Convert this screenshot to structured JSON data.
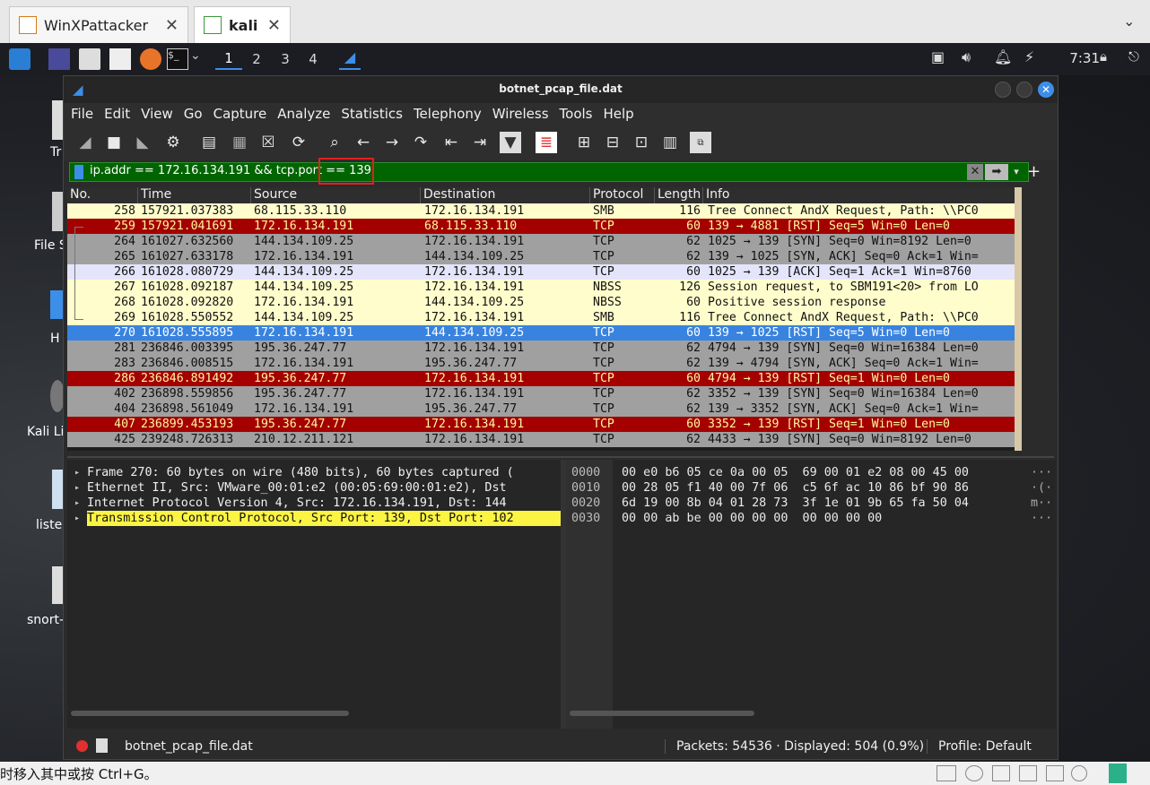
{
  "host": {
    "tabs": [
      {
        "label": "WinXPattacker"
      },
      {
        "label": "kali"
      }
    ],
    "status_hint": "时移入其中或按 Ctrl+G。"
  },
  "kali_panel": {
    "workspaces": [
      "1",
      "2",
      "3",
      "4"
    ],
    "clock": "7:31"
  },
  "desktop": {
    "icons": [
      {
        "label": "Tr"
      },
      {
        "label": "File S"
      },
      {
        "label": "H"
      },
      {
        "label": "Kali Li"
      },
      {
        "label": "liste"
      },
      {
        "label": "snort-"
      }
    ]
  },
  "window": {
    "title": "botnet_pcap_file.dat",
    "menus": [
      "File",
      "Edit",
      "View",
      "Go",
      "Capture",
      "Analyze",
      "Statistics",
      "Telephony",
      "Wireless",
      "Tools",
      "Help"
    ],
    "filter": "ip.addr == 172.16.134.191 && tcp.port == 139",
    "columns": [
      "No.",
      "Time",
      "Source",
      "Destination",
      "Protocol",
      "Length",
      "Info"
    ],
    "packets": [
      {
        "no": "258",
        "time": "157921.037383",
        "src": "68.115.33.110",
        "dst": "172.16.134.191",
        "proto": "SMB",
        "len": "116",
        "info": "Tree Connect AndX Request, Path: \\\\PC0",
        "style": "yellow"
      },
      {
        "no": "259",
        "time": "157921.041691",
        "src": "172.16.134.191",
        "dst": "68.115.33.110",
        "proto": "TCP",
        "len": "60",
        "info": "139 → 4881 [RST] Seq=5 Win=0 Len=0",
        "style": "red"
      },
      {
        "no": "264",
        "time": "161027.632560",
        "src": "144.134.109.25",
        "dst": "172.16.134.191",
        "proto": "TCP",
        "len": "62",
        "info": "1025 → 139 [SYN] Seq=0 Win=8192 Len=0",
        "style": "gray"
      },
      {
        "no": "265",
        "time": "161027.633178",
        "src": "172.16.134.191",
        "dst": "144.134.109.25",
        "proto": "TCP",
        "len": "62",
        "info": "139 → 1025 [SYN, ACK] Seq=0 Ack=1 Win=",
        "style": "gray"
      },
      {
        "no": "266",
        "time": "161028.080729",
        "src": "144.134.109.25",
        "dst": "172.16.134.191",
        "proto": "TCP",
        "len": "60",
        "info": "1025 → 139 [ACK] Seq=1 Ack=1 Win=8760",
        "style": "lav"
      },
      {
        "no": "267",
        "time": "161028.092187",
        "src": "144.134.109.25",
        "dst": "172.16.134.191",
        "proto": "NBSS",
        "len": "126",
        "info": "Session request, to SBM191<20> from LO",
        "style": "yellow"
      },
      {
        "no": "268",
        "time": "161028.092820",
        "src": "172.16.134.191",
        "dst": "144.134.109.25",
        "proto": "NBSS",
        "len": "60",
        "info": "Positive session response",
        "style": "yellow"
      },
      {
        "no": "269",
        "time": "161028.550552",
        "src": "144.134.109.25",
        "dst": "172.16.134.191",
        "proto": "SMB",
        "len": "116",
        "info": "Tree Connect AndX Request, Path: \\\\PC0",
        "style": "yellow"
      },
      {
        "no": "270",
        "time": "161028.555895",
        "src": "172.16.134.191",
        "dst": "144.134.109.25",
        "proto": "TCP",
        "len": "60",
        "info": "139 → 1025 [RST] Seq=5 Win=0 Len=0",
        "style": "sel"
      },
      {
        "no": "281",
        "time": "236846.003395",
        "src": "195.36.247.77",
        "dst": "172.16.134.191",
        "proto": "TCP",
        "len": "62",
        "info": "4794 → 139 [SYN] Seq=0 Win=16384 Len=0",
        "style": "gray"
      },
      {
        "no": "283",
        "time": "236846.008515",
        "src": "172.16.134.191",
        "dst": "195.36.247.77",
        "proto": "TCP",
        "len": "62",
        "info": "139 → 4794 [SYN, ACK] Seq=0 Ack=1 Win=",
        "style": "gray"
      },
      {
        "no": "286",
        "time": "236846.891492",
        "src": "195.36.247.77",
        "dst": "172.16.134.191",
        "proto": "TCP",
        "len": "60",
        "info": "4794 → 139 [RST] Seq=1 Win=0 Len=0",
        "style": "red"
      },
      {
        "no": "402",
        "time": "236898.559856",
        "src": "195.36.247.77",
        "dst": "172.16.134.191",
        "proto": "TCP",
        "len": "62",
        "info": "3352 → 139 [SYN] Seq=0 Win=16384 Len=0",
        "style": "gray"
      },
      {
        "no": "404",
        "time": "236898.561049",
        "src": "172.16.134.191",
        "dst": "195.36.247.77",
        "proto": "TCP",
        "len": "62",
        "info": "139 → 3352 [SYN, ACK] Seq=0 Ack=1 Win=",
        "style": "gray"
      },
      {
        "no": "407",
        "time": "236899.453193",
        "src": "195.36.247.77",
        "dst": "172.16.134.191",
        "proto": "TCP",
        "len": "60",
        "info": "3352 → 139 [RST] Seq=1 Win=0 Len=0",
        "style": "red"
      },
      {
        "no": "425",
        "time": "239248.726313",
        "src": "210.12.211.121",
        "dst": "172.16.134.191",
        "proto": "TCP",
        "len": "62",
        "info": "4433 → 139 [SYN] Seq=0 Win=8192 Len=0",
        "style": "gray"
      }
    ],
    "details": [
      {
        "text": "Frame 270: 60 bytes on wire (480 bits), 60 bytes captured (",
        "highlight": false
      },
      {
        "text": "Ethernet II, Src: VMware_00:01:e2 (00:05:69:00:01:e2), Dst",
        "highlight": false
      },
      {
        "text": "Internet Protocol Version 4, Src: 172.16.134.191, Dst: 144",
        "highlight": false
      },
      {
        "text": "Transmission Control Protocol, Src Port: 139, Dst Port: 102",
        "highlight": true
      }
    ],
    "bytes": [
      {
        "offset": "0000",
        "hex": "00 e0 b6 05 ce 0a 00 05  69 00 01 e2 08 00 45 00",
        "ascii": "···"
      },
      {
        "offset": "0010",
        "hex": "00 28 05 f1 40 00 7f 06  c5 6f ac 10 86 bf 90 86",
        "ascii": "·(·"
      },
      {
        "offset": "0020",
        "hex": "6d 19 00 8b 04 01 28 73  3f 1e 01 9b 65 fa 50 04",
        "ascii": "m··"
      },
      {
        "offset": "0030",
        "hex": "00 00 ab be 00 00 00 00  00 00 00 00",
        "ascii": "···"
      }
    ],
    "status": {
      "file": "botnet_pcap_file.dat",
      "packets": "Packets: 54536 · Displayed: 504 (0.9%)",
      "profile": "Profile: Default"
    }
  }
}
